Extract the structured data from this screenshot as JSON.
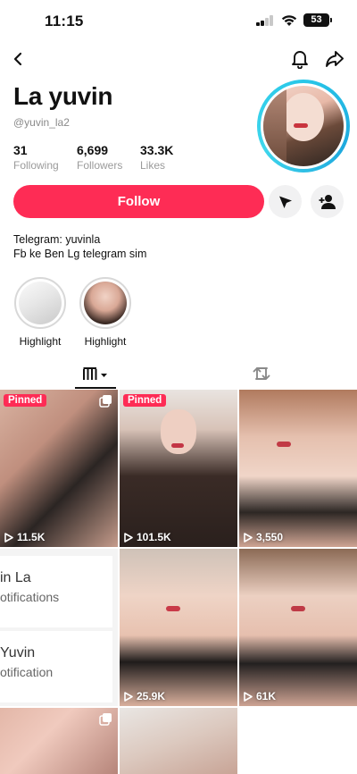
{
  "status_bar": {
    "time": "11:15",
    "battery": "53"
  },
  "profile": {
    "name": "La yuvin",
    "handle": "@yuvin_la2",
    "stats": [
      {
        "value": "31",
        "label": "Following"
      },
      {
        "value": "6,699",
        "label": "Followers"
      },
      {
        "value": "33.3K",
        "label": "Likes"
      }
    ],
    "follow_label": "Follow",
    "bio": [
      "Telegram: yuvinla",
      "Fb ke Ben Lg telegram sim"
    ]
  },
  "highlights": [
    {
      "label": "Highlight"
    },
    {
      "label": "Highlight"
    }
  ],
  "icons": {
    "back": "chevron-left-icon",
    "bell": "bell-icon",
    "share": "share-icon",
    "message": "send-message-icon",
    "add_friend": "add-friend-icon",
    "videos_tab": "grid-icon",
    "reposts_tab": "repost-icon",
    "play": "play-icon"
  },
  "colors": {
    "accent": "#fe2c55",
    "avatar_ring": "#28c7e8"
  },
  "videos": [
    {
      "pinned_label": "Pinned",
      "views": "11.5K",
      "multi": true
    },
    {
      "pinned_label": "Pinned",
      "views": "101.5K",
      "multi": false
    },
    {
      "pinned_label": "",
      "views": "3,550",
      "multi": false
    },
    {
      "pinned_label": "",
      "views": "",
      "multi": false,
      "overlay_lines": [
        "in La",
        "otifications",
        "Yuvin",
        "otification"
      ]
    },
    {
      "pinned_label": "",
      "views": "25.9K",
      "multi": false
    },
    {
      "pinned_label": "",
      "views": "61K",
      "multi": false
    },
    {
      "pinned_label": "",
      "views": "",
      "multi": true
    },
    {
      "pinned_label": "",
      "views": "",
      "multi": false
    }
  ]
}
